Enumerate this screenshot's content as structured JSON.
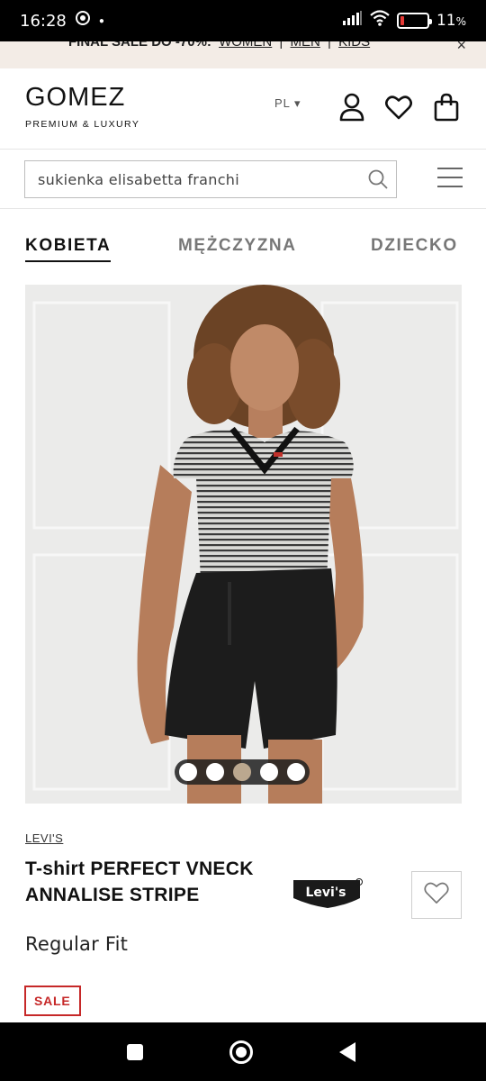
{
  "status_bar": {
    "time": "16:28",
    "battery_pct": "11",
    "battery_unit": "%"
  },
  "promo": {
    "text": "FINAL SALE DO -70%:",
    "links": [
      "WOMEN",
      "MEN",
      "KIDS"
    ],
    "separator": "|",
    "close": "×"
  },
  "header": {
    "logo_main": "GOMEZ",
    "logo_sub": "PREMIUM & LUXURY",
    "lang": "PL ▾"
  },
  "search": {
    "placeholder": "sukienka elisabetta franchi"
  },
  "tabs": [
    {
      "label": "KOBIETA",
      "active": true
    },
    {
      "label": "MĘŻCZYZNA",
      "active": false
    },
    {
      "label": "DZIECKO",
      "active": false
    }
  ],
  "gallery": {
    "total_images": 5,
    "active_index": 2
  },
  "product": {
    "brand": "LEVI'S",
    "title": "T-shirt PERFECT VNECK ANNALISE STRIPE",
    "fit": "Regular Fit",
    "brand_logo_text": "Levi's",
    "badge": "SALE"
  },
  "colors": {
    "sale": "#c62828",
    "active_dot": "#bba88f",
    "promo_bg": "#f3ece6"
  }
}
